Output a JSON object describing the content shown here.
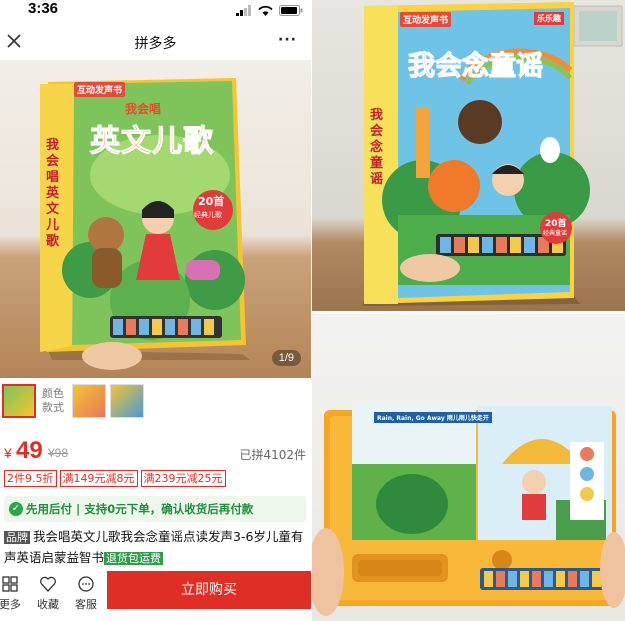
{
  "status": {
    "time": "3:36"
  },
  "nav": {
    "title": "拼多多",
    "more": "···"
  },
  "gallery": {
    "counter": "1/9",
    "book1": {
      "badge": "互动发声书",
      "subtitle": "我会唱",
      "title": "英文儿歌",
      "spine": "我会唱英文儿歌",
      "count": "20首",
      "count_sub": "经典儿歌"
    }
  },
  "swatch_caption": "颜色款式",
  "price": {
    "symbol": "¥",
    "value": "49",
    "original": "¥98",
    "sold": "已拼4102件"
  },
  "coupons": [
    "2件9.5折",
    "满149元减8元",
    "满239元减25元"
  ],
  "paylater": {
    "icon": "✓",
    "text": "先用后付 | 支持0元下单，确认收货后再付款"
  },
  "product": {
    "brand_tag": "品牌",
    "title": "我会唱英文儿歌我会念童谣点读发声3-6岁儿童有声英语启蒙益智书",
    "return_tag": "退货包运费"
  },
  "bottombar": {
    "more": "更多",
    "favorite": "收藏",
    "service": "客服",
    "buy": "立即购买"
  },
  "photo_top": {
    "badge": "互动发声书",
    "brand": "乐乐趣",
    "title": "我会念童谣",
    "spine": "我会念童谣",
    "count": "20首",
    "count_sub": "经典童谣"
  },
  "photo_bottom": {
    "song_title": "Rain, Rain, Go Away 雨儿雨儿快走开"
  },
  "colors": {
    "accent": "#e02e24",
    "green": "#2e9c4b"
  }
}
